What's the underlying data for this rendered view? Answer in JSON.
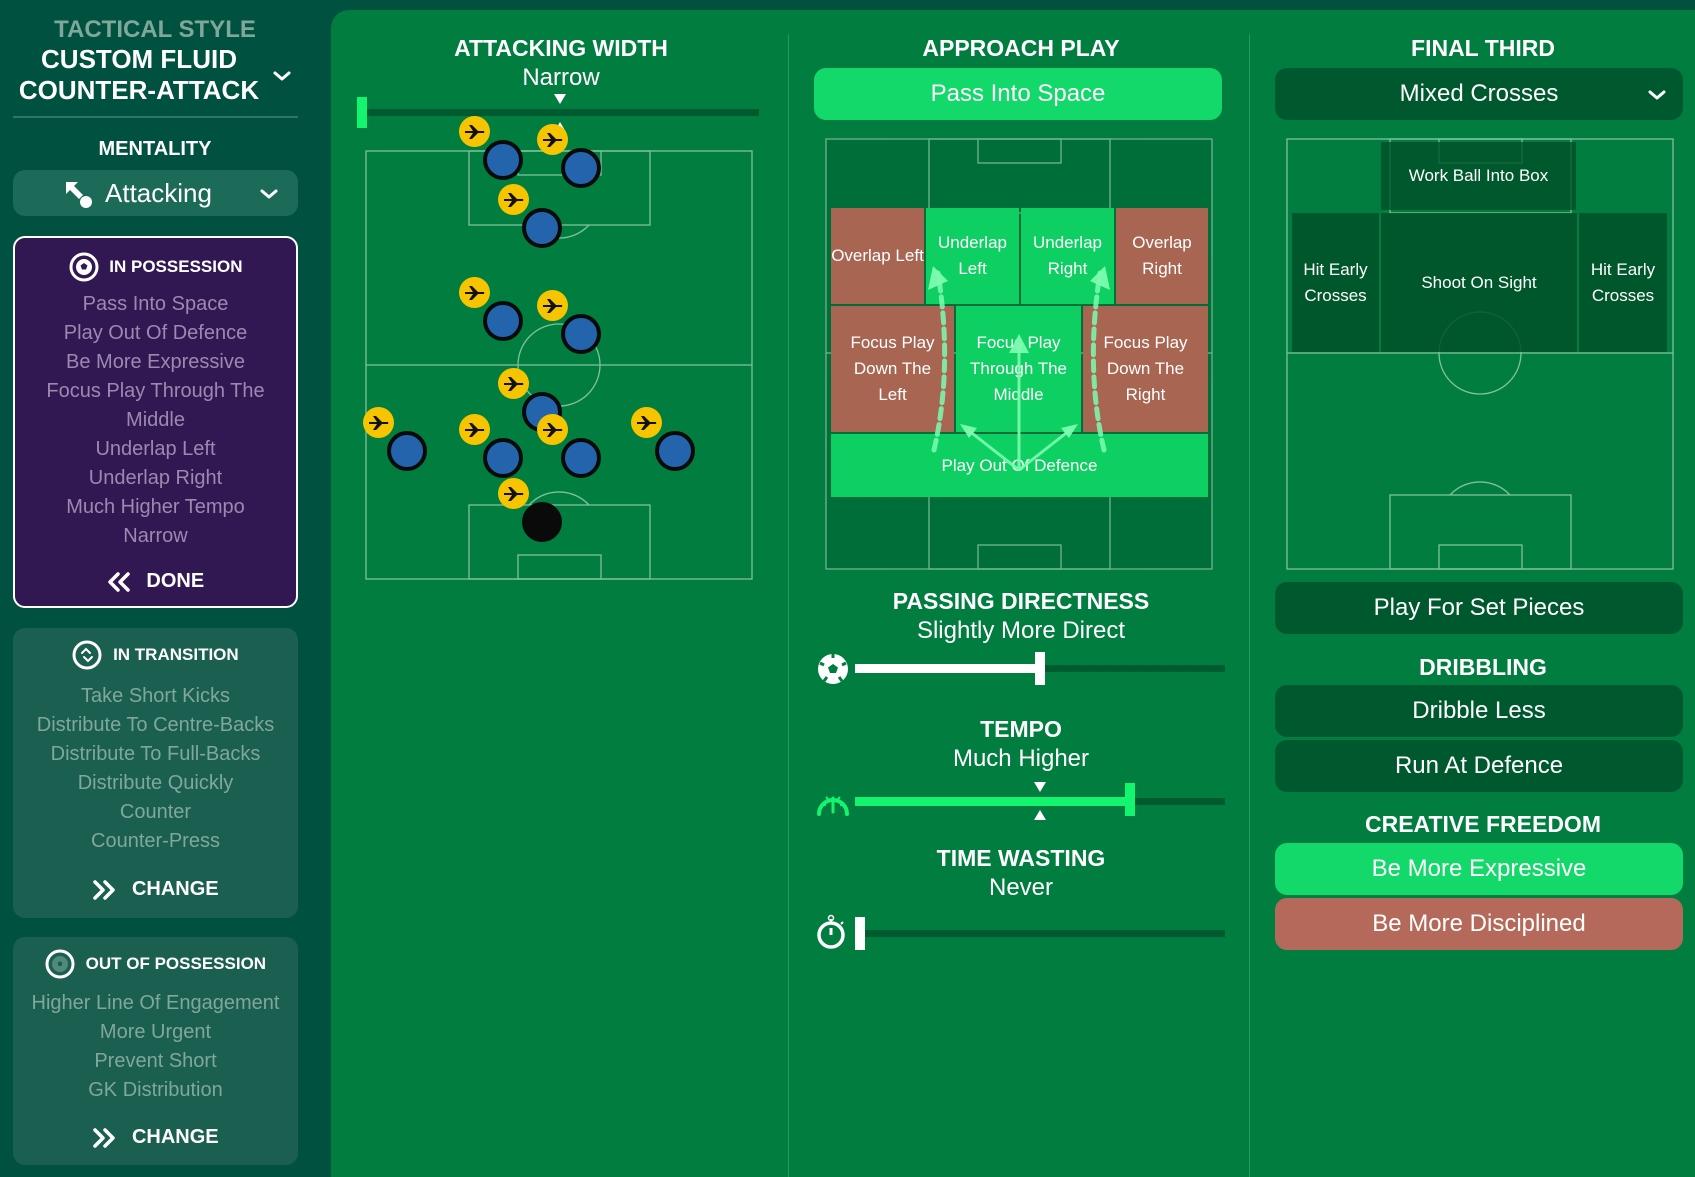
{
  "sidebar": {
    "tactical_style_label": "TACTICAL STYLE",
    "tactical_style_name": "CUSTOM FLUID COUNTER-ATTACK",
    "mentality_label": "MENTALITY",
    "mentality_value": "Attacking",
    "cards": [
      {
        "title": "IN POSSESSION",
        "icon": "football-icon",
        "state": "active",
        "items": [
          "Pass Into Space",
          "Play Out Of Defence",
          "Be More Expressive",
          "Focus Play Through The Middle",
          "Underlap Left",
          "Underlap Right",
          "Much Higher Tempo",
          "Narrow"
        ],
        "action_label": "DONE"
      },
      {
        "title": "IN TRANSITION",
        "icon": "transition-icon",
        "state": "inactive",
        "items": [
          "Take Short Kicks",
          "Distribute To Centre-Backs",
          "Distribute To Full-Backs",
          "Distribute Quickly",
          "Counter",
          "Counter-Press"
        ],
        "action_label": "CHANGE"
      },
      {
        "title": "OUT OF POSSESSION",
        "icon": "football-outline-icon",
        "state": "inactive",
        "items": [
          "Higher Line Of Engagement",
          "More Urgent",
          "Prevent Short GK Distribution"
        ],
        "action_label": "CHANGE"
      }
    ]
  },
  "attacking_width": {
    "title": "ATTACKING WIDTH",
    "value": "Narrow",
    "slider_fraction": 0.0,
    "default_marker_fraction": 0.5
  },
  "approach_play": {
    "title": "APPROACH PLAY",
    "selected": "Pass Into Space",
    "zones": {
      "overlap_left": "Overlap Left",
      "underlap_left": "Underlap Left",
      "underlap_right": "Underlap Right",
      "overlap_right": "Overlap Right",
      "focus_left": "Focus Play Down The Left",
      "focus_middle": "Focus Play Through The Middle",
      "focus_right": "Focus Play Down The Right",
      "play_out": "Play Out Of Defence"
    },
    "zone_states": {
      "overlap_left": "rejected",
      "underlap_left": "selected",
      "underlap_right": "selected",
      "overlap_right": "rejected",
      "focus_left": "rejected",
      "focus_middle": "selected",
      "focus_right": "rejected",
      "play_out": "selected"
    }
  },
  "passing_directness": {
    "title": "PASSING DIRECTNESS",
    "value": "Slightly More Direct",
    "slider_fraction": 0.5
  },
  "tempo": {
    "title": "TEMPO",
    "value": "Much Higher",
    "slider_fraction": 0.75,
    "default_marker_fraction": 0.5
  },
  "time_wasting": {
    "title": "TIME WASTING",
    "value": "Never",
    "slider_fraction": 0.0
  },
  "final_third": {
    "title": "FINAL THIRD",
    "crossing_selected": "Mixed Crosses",
    "zones": {
      "work_ball": "Work Ball Into Box",
      "hit_early_left": "Hit Early Crosses",
      "shoot_on_sight": "Shoot On Sight",
      "hit_early_right": "Hit Early Crosses"
    },
    "set_pieces": "Play For Set Pieces"
  },
  "dribbling": {
    "title": "DRIBBLING",
    "options": [
      "Dribble Less",
      "Run At Defence"
    ]
  },
  "creative_freedom": {
    "title": "CREATIVE FREEDOM",
    "options": [
      {
        "label": "Be More Expressive",
        "state": "selected"
      },
      {
        "label": "Be More Disciplined",
        "state": "rejected"
      }
    ]
  },
  "colors": {
    "sidebar_bg": "#00513f",
    "main_bg": "#017d40",
    "selected_green": "#13d96a",
    "rejected_red": "#b5695a",
    "dark_option": "#00592e",
    "active_card_purple": "#321852",
    "player_blue": "#2464ad",
    "role_badge_yellow": "#f7c500"
  }
}
